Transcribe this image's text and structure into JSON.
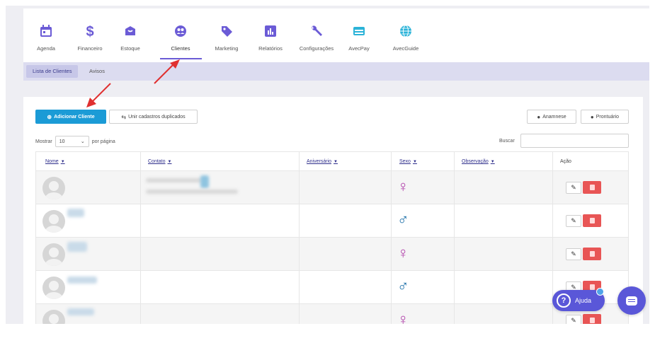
{
  "nav": {
    "items": [
      {
        "label": "Agenda",
        "icon": "calendar-icon",
        "color": "#6b5bd6"
      },
      {
        "label": "Financeiro",
        "icon": "dollar-icon",
        "color": "#6b5bd6"
      },
      {
        "label": "Estoque",
        "icon": "box-icon",
        "color": "#6b5bd6"
      },
      {
        "label": "Clientes",
        "icon": "clients-icon",
        "color": "#6b5bd6"
      },
      {
        "label": "Marketing",
        "icon": "tag-icon",
        "color": "#6b5bd6"
      },
      {
        "label": "Relatórios",
        "icon": "report-icon",
        "color": "#6b5bd6"
      },
      {
        "label": "Configurações",
        "icon": "wrench-icon",
        "color": "#6b5bd6"
      },
      {
        "label": "AvecPay",
        "icon": "card-icon",
        "color": "#2bb3d8"
      },
      {
        "label": "AvecGuide",
        "icon": "globe-icon",
        "color": "#2bb3d8"
      }
    ],
    "active": "Clientes"
  },
  "subnav": {
    "tabs": [
      {
        "label": "Lista de Clientes",
        "active": true
      },
      {
        "label": "Avisos",
        "active": false
      }
    ]
  },
  "toolbar": {
    "add_client": "Adicionar Cliente",
    "merge_duplicates": "Unir cadastros duplicados",
    "anamnese": "Anamnese",
    "prontuario": "Prontuário"
  },
  "list_controls": {
    "show_label": "Mostrar",
    "per_page_value": "10",
    "per_page_suffix": "por página",
    "search_label": "Buscar",
    "search_value": ""
  },
  "table": {
    "columns": [
      {
        "label": "Nome",
        "sortable": true
      },
      {
        "label": "Contato",
        "sortable": true
      },
      {
        "label": "Aniversário",
        "sortable": true
      },
      {
        "label": "Sexo",
        "sortable": true
      },
      {
        "label": "Observação",
        "sortable": true
      },
      {
        "label": "Ação",
        "sortable": false
      }
    ],
    "rows": [
      {
        "sex": "♀",
        "sex_kind": "female"
      },
      {
        "sex": "♂",
        "sex_kind": "male"
      },
      {
        "sex": "♀",
        "sex_kind": "female"
      },
      {
        "sex": "♂",
        "sex_kind": "male"
      },
      {
        "sex": "♀",
        "sex_kind": "female"
      }
    ]
  },
  "help": {
    "label": "Ajuda"
  },
  "colors": {
    "brand": "#6b5bd6",
    "primary_button": "#1b9bd6",
    "delete_button": "#e85555",
    "female": "#b03fa9",
    "male": "#1c6fa8",
    "annotation_arrow": "#e03030"
  }
}
